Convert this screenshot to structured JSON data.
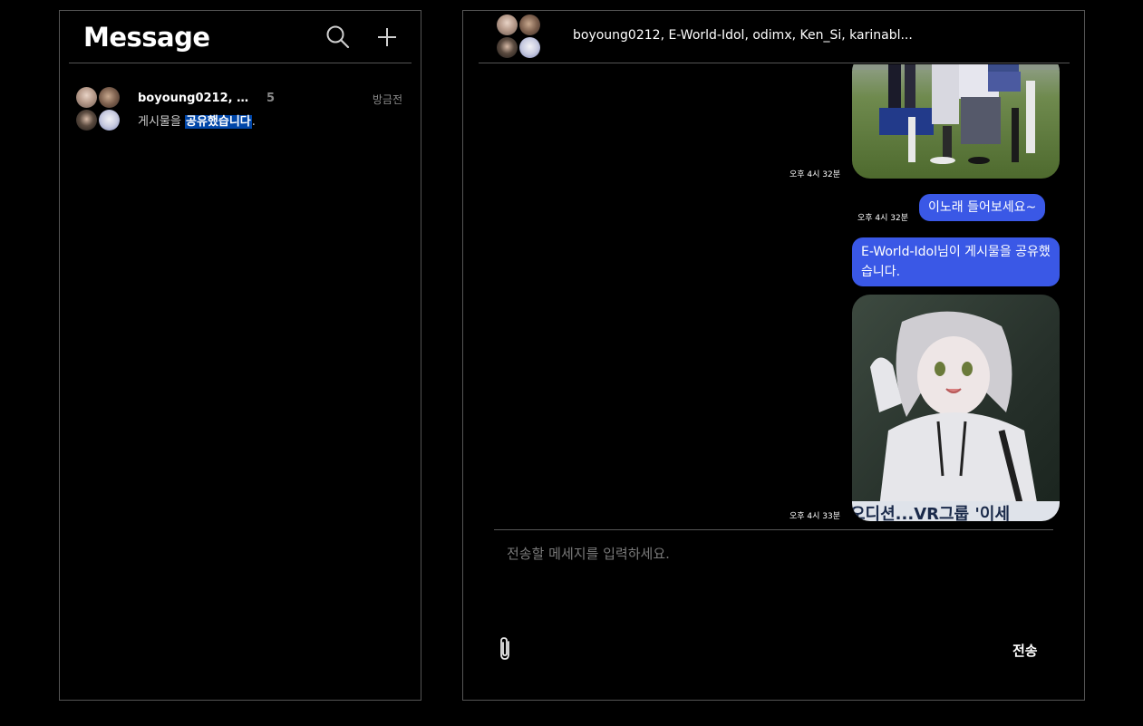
{
  "sidebar": {
    "title": "Message",
    "conversations": [
      {
        "name": "boyoung0212, E-...",
        "unread": "5",
        "time": "방금전",
        "preview_prefix": "게시물을 ",
        "preview_highlight": "공유했습니다",
        "preview_suffix": "."
      }
    ]
  },
  "room": {
    "title": "boyoung0212, E-World-Idol, odimx, Ken_Si, karinabl..."
  },
  "messages": [
    {
      "type": "image",
      "desc_icon": "dancers-photo",
      "time": "오후 4시 32분"
    },
    {
      "type": "text",
      "text": "이노래 들어보세요~",
      "time": "오후 4시 32분"
    },
    {
      "type": "text",
      "text": "E-World-Idol님이 게시물을 공유했습니다."
    },
    {
      "type": "image",
      "desc_icon": "avatar-character-photo",
      "caption": "오디션...VR그룹 '이세",
      "time": "오후 4시 33분"
    }
  ],
  "composer": {
    "placeholder": "전송할 메세지를 입력하세요.",
    "send_label": "전송"
  },
  "colors": {
    "bubble": "#3a58e6",
    "highlight": "#0046a8",
    "border": "#555555"
  }
}
